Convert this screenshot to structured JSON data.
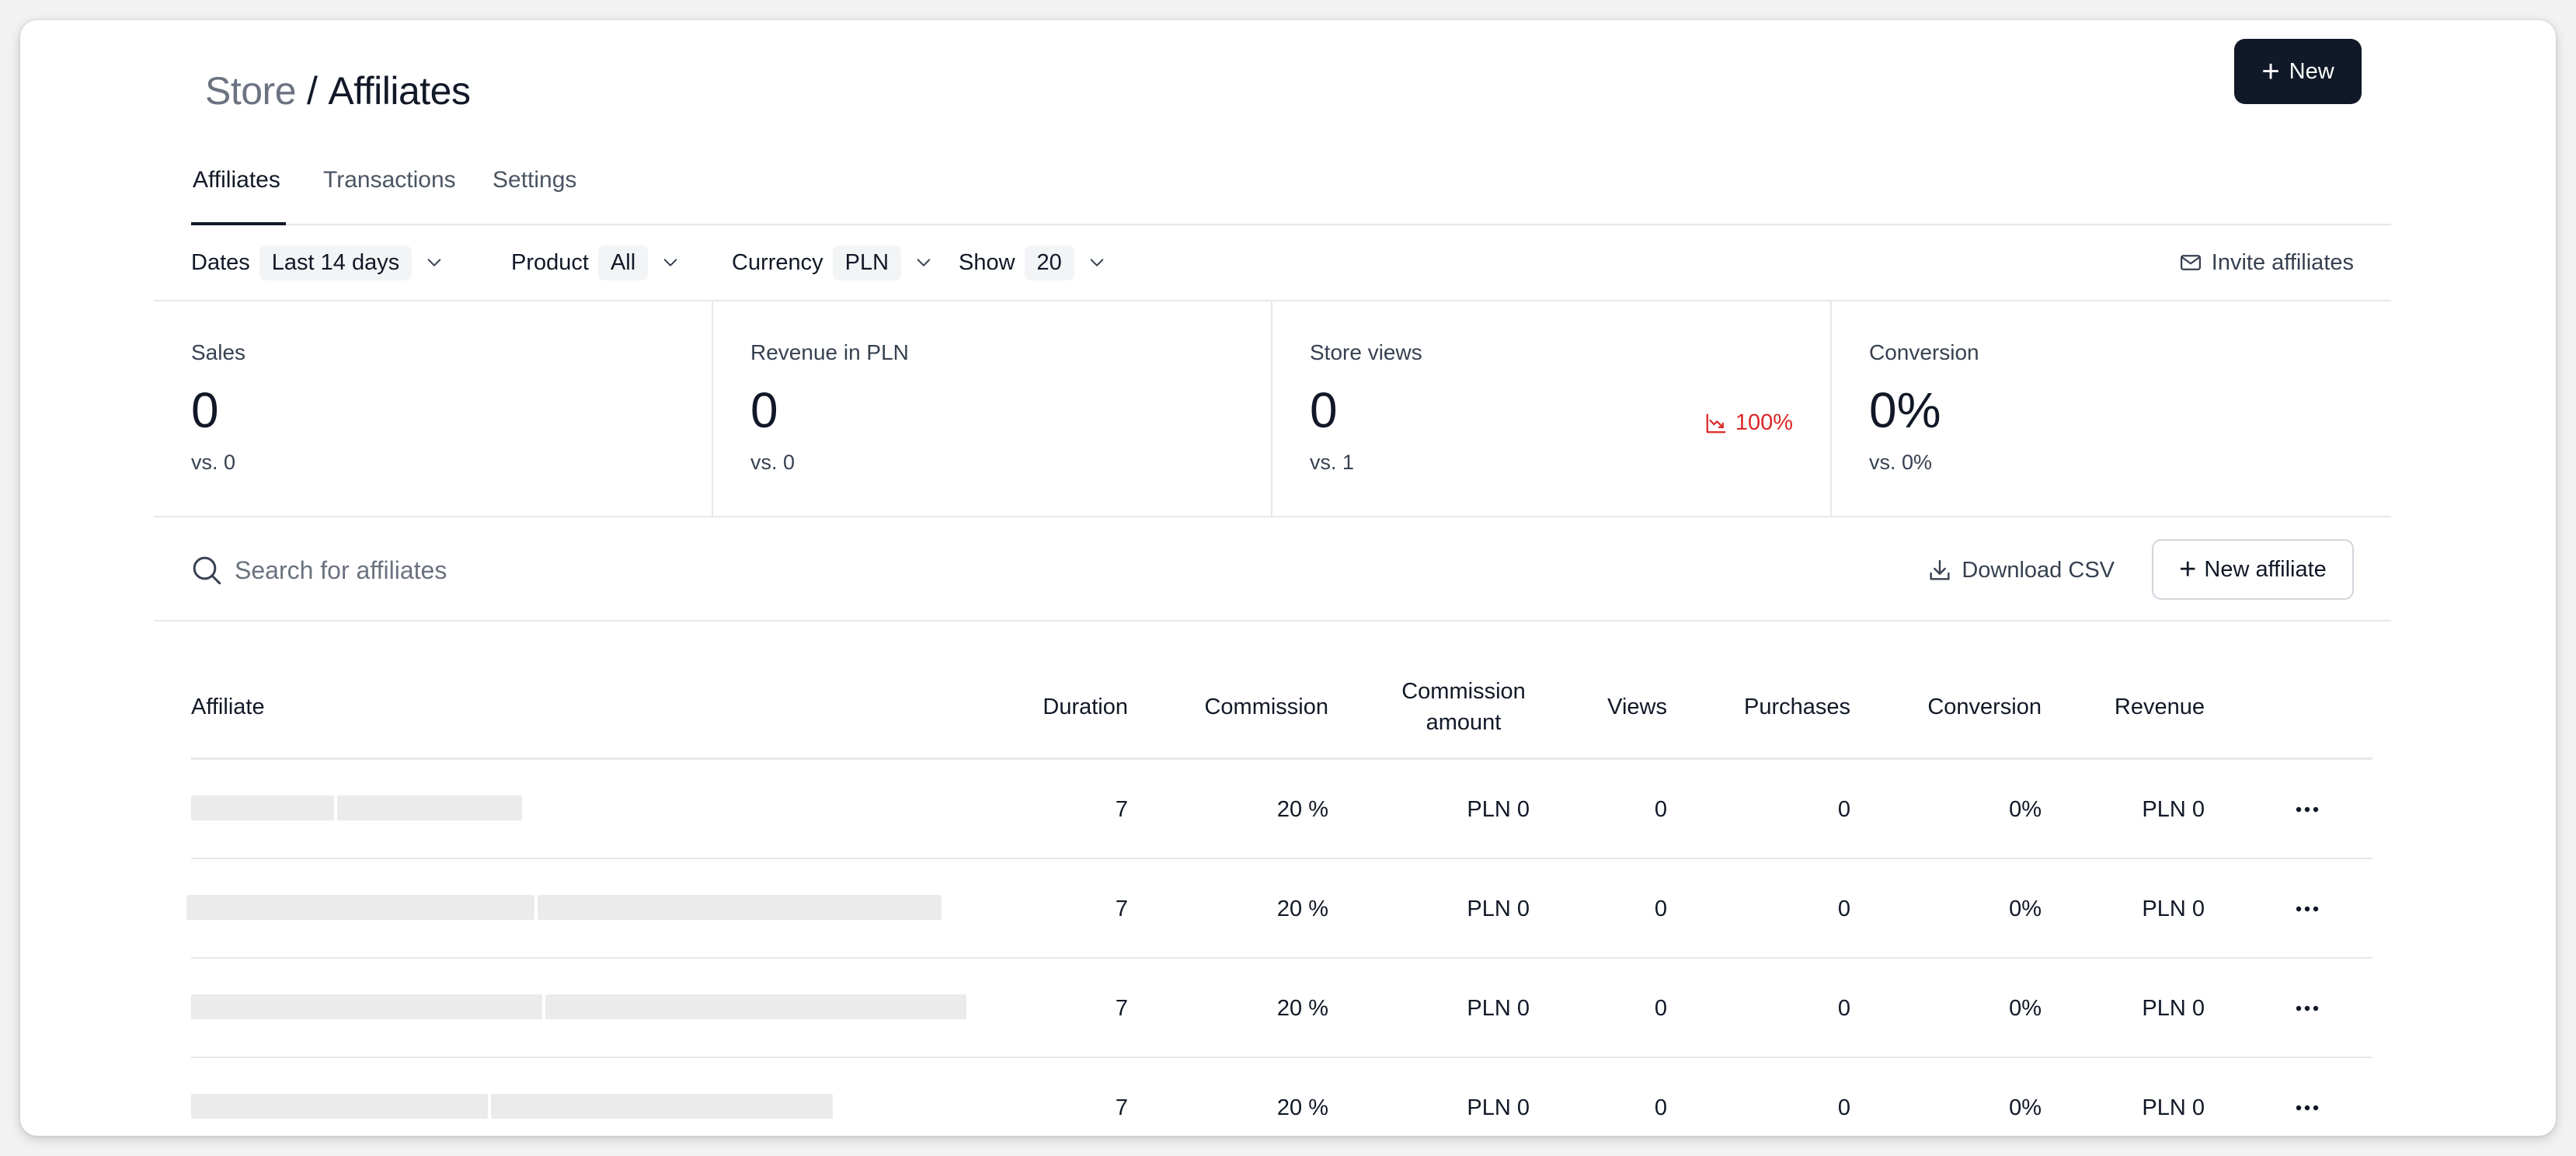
{
  "header": {
    "breadcrumb_parent": "Store",
    "breadcrumb_separator": "/",
    "breadcrumb_current": "Affiliates",
    "new_button_label": "New"
  },
  "tabs": [
    {
      "label": "Affiliates",
      "active": true
    },
    {
      "label": "Transactions",
      "active": false
    },
    {
      "label": "Settings",
      "active": false
    }
  ],
  "filters": {
    "dates": {
      "label": "Dates",
      "value": "Last 14 days"
    },
    "product": {
      "label": "Product",
      "value": "All"
    },
    "currency": {
      "label": "Currency",
      "value": "PLN"
    },
    "show": {
      "label": "Show",
      "value": "20"
    },
    "invite_label": "Invite affiliates"
  },
  "stats": [
    {
      "label": "Sales",
      "value": "0",
      "vs": "vs. 0"
    },
    {
      "label": "Revenue in PLN",
      "value": "0",
      "vs": "vs. 0"
    },
    {
      "label": "Store views",
      "value": "0",
      "vs": "vs. 1",
      "trend": "100%",
      "trend_color": "#dc2626"
    },
    {
      "label": "Conversion",
      "value": "0%",
      "vs": "vs. 0%"
    }
  ],
  "search": {
    "placeholder": "Search for affiliates",
    "download_label": "Download CSV",
    "new_affiliate_label": "New affiliate"
  },
  "table": {
    "headers": {
      "affiliate": "Affiliate",
      "duration": "Duration",
      "commission": "Commission",
      "commission_amount_1": "Commission",
      "commission_amount_2": "amount",
      "views": "Views",
      "purchases": "Purchases",
      "conversion": "Conversion",
      "revenue": "Revenue"
    },
    "rows": [
      {
        "duration": "7",
        "commission": "20 %",
        "commission_amount": "PLN 0",
        "views": "0",
        "purchases": "0",
        "conversion": "0%",
        "revenue": "PLN 0"
      },
      {
        "duration": "7",
        "commission": "20 %",
        "commission_amount": "PLN 0",
        "views": "0",
        "purchases": "0",
        "conversion": "0%",
        "revenue": "PLN 0"
      },
      {
        "duration": "7",
        "commission": "20 %",
        "commission_amount": "PLN 0",
        "views": "0",
        "purchases": "0",
        "conversion": "0%",
        "revenue": "PLN 0"
      },
      {
        "duration": "7",
        "commission": "20 %",
        "commission_amount": "PLN 0",
        "views": "0",
        "purchases": "0",
        "conversion": "0%",
        "revenue": "PLN 0"
      }
    ]
  }
}
